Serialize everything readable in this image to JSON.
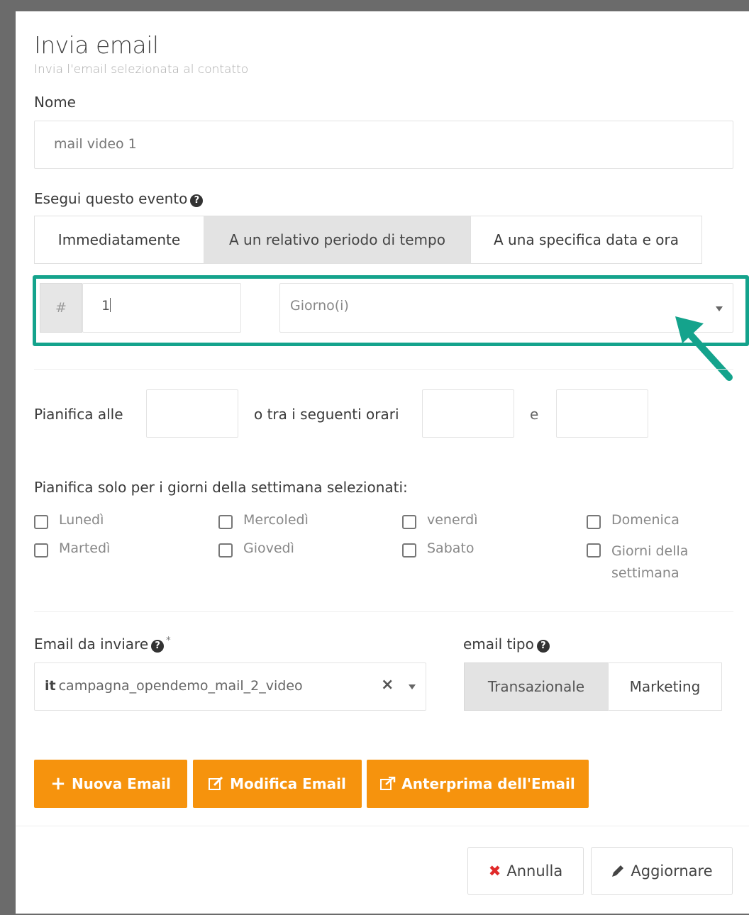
{
  "modal": {
    "title": "Invia email",
    "subtitle": "Invia l'email selezionata al contatto"
  },
  "name_field": {
    "label": "Nome",
    "value": "mail video 1"
  },
  "trigger": {
    "label": "Esegui questo evento",
    "options": [
      "Immediatamente",
      "A un relativo periodo di tempo",
      "A una specifica data e ora"
    ],
    "selected": "A un relativo periodo di tempo"
  },
  "interval": {
    "addon": "#",
    "value": "1",
    "unit": "Giorno(i)"
  },
  "schedule": {
    "label_at": "Pianifica alle",
    "label_between": "o tra i seguenti orari",
    "label_and": "e"
  },
  "weekdays": {
    "label": "Pianifica solo per i giorni della settimana selezionati:",
    "days": [
      "Lunedì",
      "Martedì",
      "Mercoledì",
      "Giovedì",
      "venerdì",
      "Sabato",
      "Domenica",
      "Giorni della",
      "settimana"
    ]
  },
  "email_to_send": {
    "label": "Email da inviare",
    "required_mark": "*",
    "lang_prefix": "it",
    "value": "campagna_opendemo_mail_2_video"
  },
  "email_type": {
    "label": "email tipo",
    "options": [
      "Transazionale",
      "Marketing"
    ],
    "selected": "Transazionale"
  },
  "actions": {
    "new_email": "Nuova Email",
    "edit_email": "Modifica Email",
    "preview_email": "Anterprima dell'Email"
  },
  "footer": {
    "cancel": "Annulla",
    "update": "Aggiornare"
  },
  "colors": {
    "accent_orange": "#f6930d",
    "highlight_teal": "#14a38c",
    "cancel_red": "#e02a2a"
  }
}
